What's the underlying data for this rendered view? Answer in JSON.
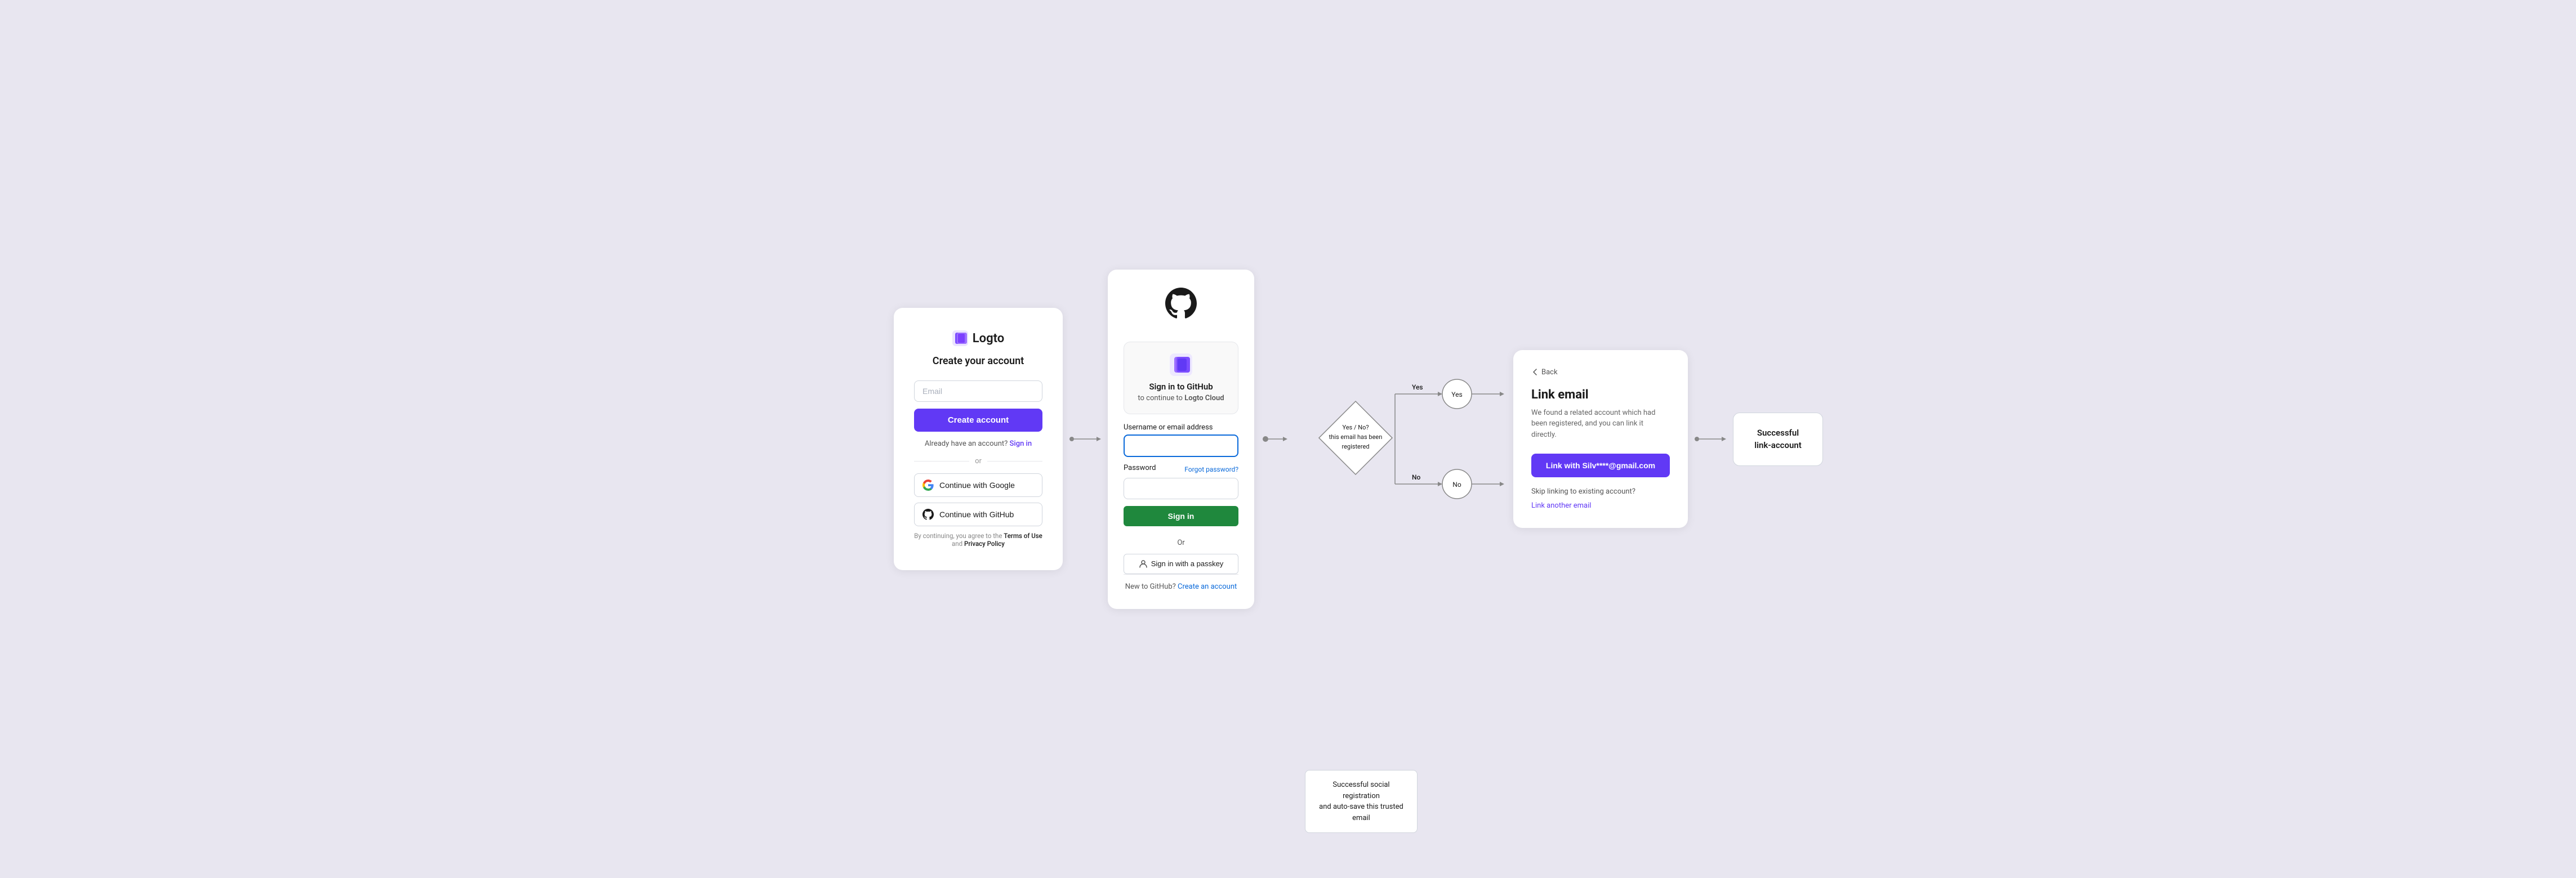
{
  "card1": {
    "logo_text": "Logto",
    "title": "Create your account",
    "email_placeholder": "Email",
    "create_account_btn": "Create account",
    "signin_text": "Already have an account?",
    "signin_link": "Sign in",
    "divider": "or",
    "google_btn": "Continue with Google",
    "github_btn": "Continue with GitHub",
    "terms_text": "By continuing, you agree to the",
    "terms_link": "Terms of Use",
    "and_text": "and",
    "privacy_link": "Privacy Policy"
  },
  "card2": {
    "title": "Sign in to GitHub",
    "subtitle": "to continue to",
    "app_name": "Logto Cloud",
    "username_label": "Username or email address",
    "password_label": "Password",
    "forgot_link": "Forgot password?",
    "signin_btn": "Sign in",
    "divider": "Or",
    "passkey_btn": "Sign in with a passkey",
    "footer_text": "New to GitHub?",
    "footer_link": "Create an account"
  },
  "flowchart": {
    "diamond_text": "Yes / No?\nthis email has been\nregistered",
    "yes_label": "Yes",
    "no_label": "No"
  },
  "card3": {
    "back_text": "Back",
    "title": "Link email",
    "description": "We found a related account which had been registered, and you can link it directly.",
    "link_btn": "Link with Silv****@gmail.com",
    "skip_text": "Skip linking to existing account?",
    "link_another": "Link another email"
  },
  "success1": {
    "text": "Successful\nlink-account"
  },
  "success2": {
    "text": "Successful social registration\nand auto-save this trusted email"
  }
}
